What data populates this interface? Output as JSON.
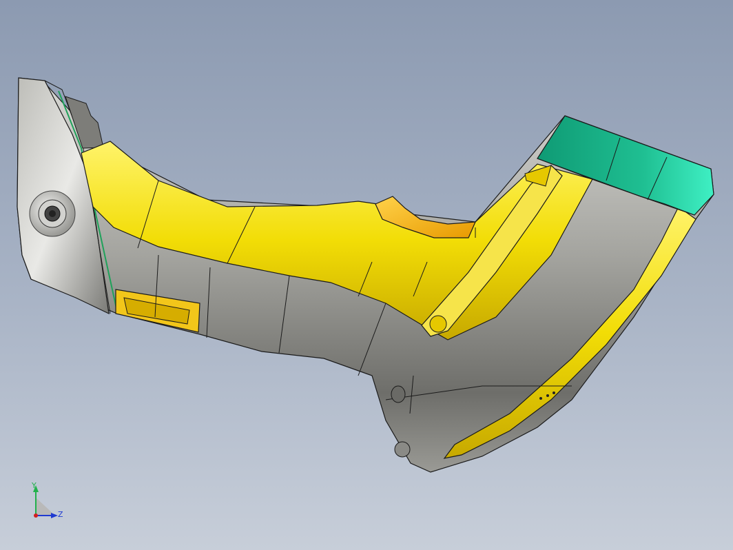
{
  "viewport": {
    "background_top": "#8c9ab1",
    "background_bottom": "#c7ced9"
  },
  "model": {
    "colors": {
      "body_gray": "#a9a9a4",
      "accent_yellow": "#f2dd06",
      "cap_teal": "#1fb48c",
      "edge": "#1a1a1a"
    }
  },
  "triad": {
    "y_label": "Y",
    "z_label": "Z",
    "y_color": "#22b14c",
    "z_color": "#1f3ad1"
  }
}
